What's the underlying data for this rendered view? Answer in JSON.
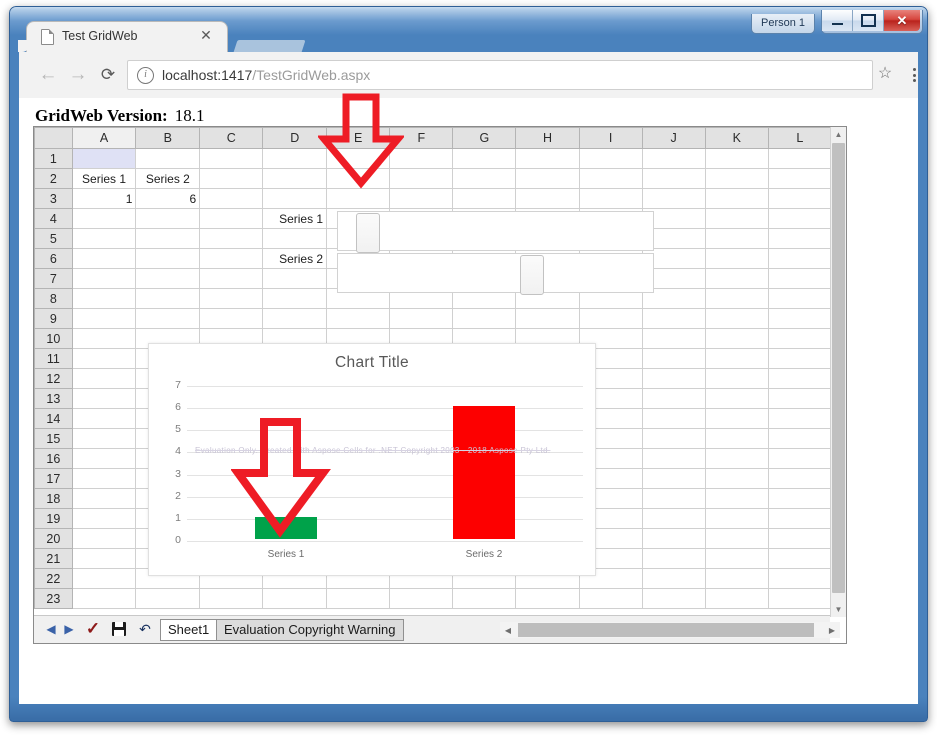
{
  "window": {
    "person_button": "Person 1",
    "minimize": "minimize-glyph",
    "maximize": "maximize-glyph",
    "close": "✕"
  },
  "browser": {
    "tab_title": "Test GridWeb",
    "tab_close": "✕",
    "back_icon": "←",
    "forward_icon": "→",
    "reload_icon": "⟳",
    "info_icon": "i",
    "url_host": "localhost:1417",
    "url_path": "/TestGridWeb.aspx",
    "star_icon": "☆"
  },
  "page": {
    "version_label": "GridWeb Version:",
    "version_value": "18.1"
  },
  "grid": {
    "columns": [
      "A",
      "B",
      "C",
      "D",
      "E",
      "F",
      "G",
      "H",
      "I",
      "J",
      "K",
      "L"
    ],
    "selected_column": "A",
    "rows": [
      "1",
      "2",
      "3",
      "4",
      "5",
      "6",
      "7",
      "8",
      "9",
      "10",
      "11",
      "12",
      "13",
      "14",
      "15",
      "16",
      "17",
      "18",
      "19",
      "20",
      "21",
      "22",
      "23"
    ],
    "cells": {
      "A1": "",
      "A2": "Series 1",
      "B2": "Series 2",
      "A3": "1",
      "B3": "6",
      "D4": "Series 1",
      "D6": "Series 2"
    },
    "selected_cell": "A1",
    "vscroll_up_icon": "▲",
    "vscroll_down_icon": "▼",
    "hscroll_left_icon": "◀",
    "hscroll_right_icon": "▶"
  },
  "sliders": [
    {
      "name": "series-1-slider",
      "value_position_pct": 6
    },
    {
      "name": "series-2-slider",
      "value_position_pct": 58
    }
  ],
  "sheet_toolbar": {
    "prev_icon": "◀",
    "next_icon": "▶",
    "ok_icon": "✓",
    "save_icon": "save-icon",
    "undo_icon": "↶",
    "sheet_name": "Sheet1",
    "warning_tab": "Evaluation Copyright Warning"
  },
  "chart_data": {
    "type": "bar",
    "title": "Chart Title",
    "categories": [
      "Series 1",
      "Series 2"
    ],
    "values": [
      1,
      6
    ],
    "colors": [
      "#00a24a",
      "#fd0000"
    ],
    "xlabel": "",
    "ylabel": "",
    "ylim": [
      0,
      7
    ],
    "yticks": [
      7,
      6,
      5,
      4,
      3,
      2,
      1,
      0
    ],
    "grid": true,
    "legend": "none",
    "watermark": "Evaluation Only. Created with Aspose.Cells for .NET Copyright 2003 - 2018 Aspose Pty Ltd."
  },
  "annotations": {
    "arrow_top": "red-down-arrow pointing at column E slider",
    "arrow_chart": "red-down-arrow pointing at Series 1 bar",
    "arrow_color": "#ee1c25"
  }
}
